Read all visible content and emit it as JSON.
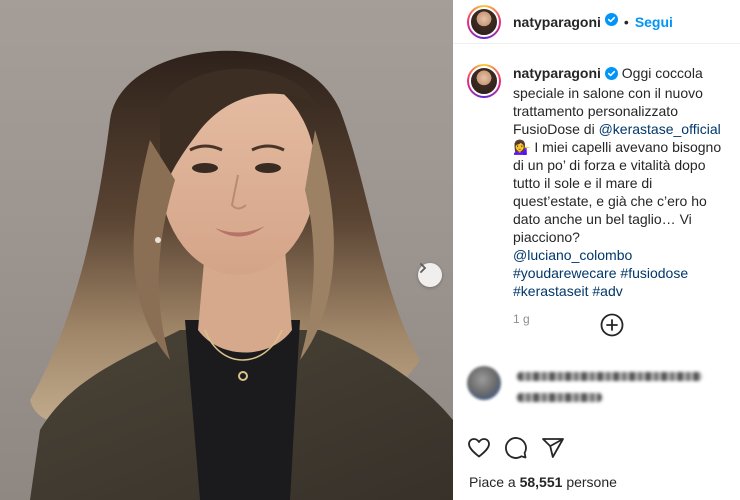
{
  "post": {
    "username": "natyparagoni",
    "separator": "•",
    "follow_label": "Segui"
  },
  "caption": {
    "username": "natyparagoni",
    "text_1": "Oggi coccola speciale in salone con il nuovo trattamento personalizzato FusioDose di",
    "mention_1": "@kerastase_official",
    "emoji": "💁‍♀️",
    "text_2": "I miei capelli avevano bisogno di un po’ di forza e vitalità dopo tutto il sole e il mare di quest’estate, e già che c’ero ho dato anche un bel taglio… Vi piacciono?",
    "mention_2": "@luciano_colombo",
    "hashtag_1": "#youdarewecare",
    "hashtag_2": "#fusiodose",
    "hashtag_3": "#kerastaseit",
    "hashtag_4": "#adv",
    "timestamp": "1 g"
  },
  "likes": {
    "prefix": "Piace a",
    "count": "58,551",
    "suffix": "persone"
  },
  "icons": {
    "verified": "verified-badge-icon",
    "next": "chevron-right-icon",
    "add_comment": "plus-circle-icon",
    "like": "heart-icon",
    "comment": "speech-bubble-icon",
    "share": "paper-plane-icon"
  },
  "colors": {
    "follow": "#0095f6",
    "link": "#00376b",
    "muted": "#8e8e8e",
    "text": "#262626"
  }
}
